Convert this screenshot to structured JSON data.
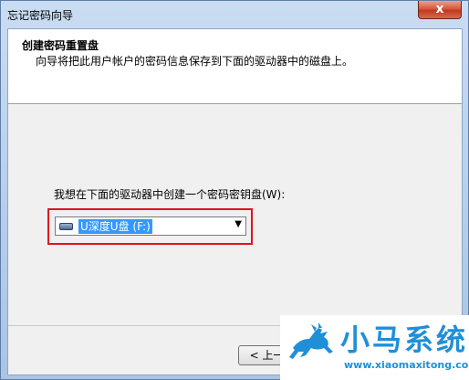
{
  "window": {
    "title": "忘记密码向导",
    "close_glyph": "x"
  },
  "header": {
    "title": "创建密码重置盘",
    "subtitle": "向导将把此用户帐户的密码信息保存到下面的驱动器中的磁盘上。"
  },
  "body": {
    "drive_label": "我想在下面的驱动器中创建一个密码密钥盘(W):"
  },
  "drive_select": {
    "icon": "usb-drive-icon",
    "selected": "U深度U盘 (F:)",
    "arrow": "▼"
  },
  "buttons": {
    "back_label": "< 上一步"
  },
  "watermark": {
    "brand": "小马系统",
    "url": "www.xiaomaxitong.com",
    "color": "#1f8fd8"
  },
  "colors": {
    "highlight_border": "#e0141d",
    "selection": "#3399ff"
  }
}
